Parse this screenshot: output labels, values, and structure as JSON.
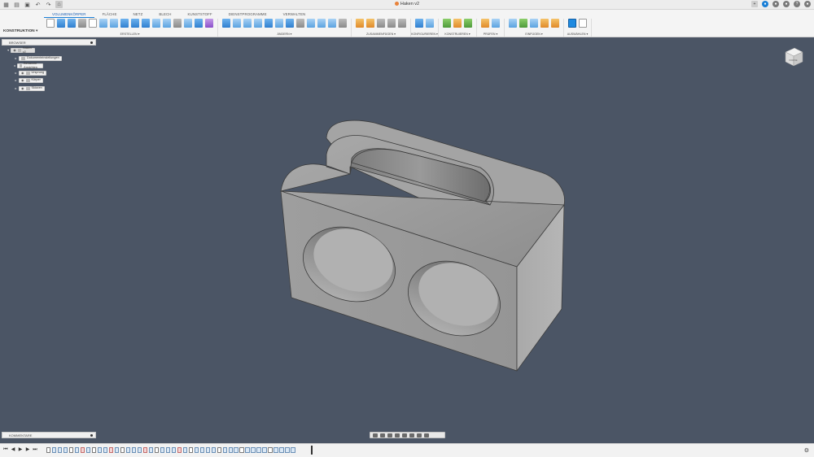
{
  "app": {
    "document_title": "Haken v2",
    "workspace": "KONSTRUKTION ▾"
  },
  "ribbon": {
    "tabs": [
      "VOLUMENKÖRPER",
      "FLÄCHE",
      "NETZ",
      "BLECH",
      "KUNSTSTOFF",
      "DIENSTPROGRAMME",
      "VERWALTEN"
    ],
    "active_tab": "VOLUMENKÖRPER",
    "groups": [
      {
        "label": "ERSTELLEN ▾",
        "icons": [
          "new-component-icon",
          "extrude-icon",
          "revolve-icon",
          "sweep-icon",
          "loft-icon",
          "rib-icon",
          "web-icon",
          "emboss-icon",
          "hole-icon",
          "thread-icon",
          "box-icon",
          "pattern-icon",
          "mirror-icon",
          "thicken-icon",
          "boundary-fill-icon",
          "create-form-icon"
        ]
      },
      {
        "label": "ÄNDERN ▾",
        "icons": [
          "press-pull-icon",
          "fillet-icon",
          "chamfer-icon",
          "shell-icon",
          "draft-icon",
          "scale-icon",
          "combine-icon",
          "move-copy-icon",
          "align-icon",
          "replace-face-icon",
          "split-face-icon",
          "parameters-icon"
        ]
      },
      {
        "label": "ZUSAMMENFÜGEN ▾",
        "icons": [
          "joint-icon",
          "as-built-joint-icon",
          "joint-origin-icon",
          "rigid-group-icon",
          "drive-joints-icon"
        ]
      },
      {
        "label": "KONFIGURIEREN ▾",
        "icons": [
          "configure-table-icon",
          "configure-rule-icon"
        ]
      },
      {
        "label": "KONSTRUIEREN ▾",
        "icons": [
          "offset-plane-icon",
          "plane-at-angle-icon",
          "axis-through-edges-icon"
        ]
      },
      {
        "label": "PRÜFEN ▾",
        "icons": [
          "measure-icon",
          "interference-icon"
        ]
      },
      {
        "label": "EINFÜGEN ▾",
        "icons": [
          "insert-derive-icon",
          "insert-mesh-icon",
          "insert-canvas-icon",
          "insert-mcmaster-icon",
          "insert-svg-icon"
        ]
      },
      {
        "label": "AUSWÄHLEN ▾",
        "icons": [
          "select-icon",
          "window-select-icon"
        ]
      }
    ]
  },
  "browser": {
    "title": "BROWSER",
    "items": [
      {
        "label": "Haken v2"
      },
      {
        "label": "Dokumenteinstellungen"
      },
      {
        "label": "Benannte Ansichten"
      },
      {
        "label": "Ursprung"
      },
      {
        "label": "Körper"
      },
      {
        "label": "Skizzen"
      }
    ]
  },
  "comments": {
    "title": "KOMMENTARE"
  },
  "viewcube": {
    "face": "VORNE"
  },
  "navigation": {
    "icons": [
      "orbit-icon",
      "look-at-icon",
      "pan-icon",
      "zoom-icon",
      "fit-icon",
      "display-settings-icon",
      "grid-icon",
      "viewports-icon"
    ]
  },
  "timeline": {
    "controls": [
      "⏮",
      "◀",
      "▶",
      "▶",
      "⏭"
    ],
    "features": [
      "s",
      "e",
      "e",
      "e",
      "s",
      "e",
      "r",
      "e",
      "s",
      "e",
      "e",
      "r",
      "e",
      "s",
      "e",
      "e",
      "e",
      "r",
      "e",
      "s",
      "e",
      "e",
      "e",
      "r",
      "e",
      "s",
      "e",
      "e",
      "e",
      "e",
      "s",
      "e",
      "e",
      "e",
      "s",
      "e",
      "e",
      "e",
      "e",
      "s",
      "e",
      "e",
      "e",
      "e"
    ]
  },
  "colors": {
    "viewport": "#4b5565",
    "part": "#9b9b9b",
    "accent": "#1a7fd6"
  }
}
